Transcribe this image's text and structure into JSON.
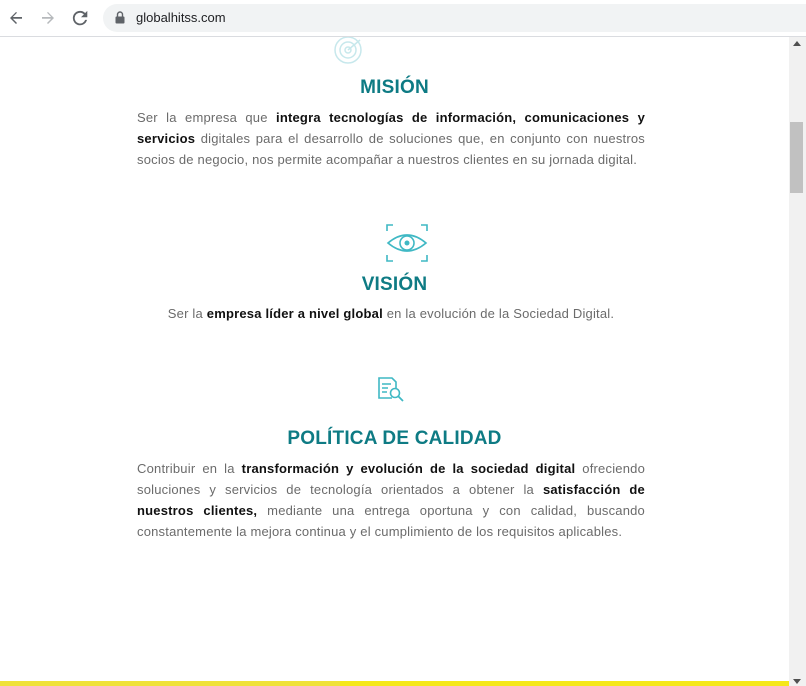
{
  "browser": {
    "url": "globalhitss.com",
    "icons": [
      "back-arrow-icon",
      "forward-arrow-icon",
      "reload-icon",
      "lock-icon"
    ]
  },
  "mision": {
    "title": "MISIÓN",
    "text": [
      {
        "t": "Ser la empresa que ",
        "b": false
      },
      {
        "t": "integra tecnologías de información, comunicaciones y servicios",
        "b": true
      },
      {
        "t": " digitales para el desarrollo de soluciones que, en conjunto con nuestros socios de negocio, nos permite acompañar a nuestros clientes en su jornada digital.",
        "b": false
      }
    ]
  },
  "vision": {
    "title": "VISIÓN",
    "icon": "eye-target-icon",
    "text": [
      {
        "t": "Ser la ",
        "b": false
      },
      {
        "t": "empresa líder a nivel global",
        "b": true
      },
      {
        "t": " en la evolución de la Sociedad Digital.",
        "b": false
      }
    ]
  },
  "calidad": {
    "title": "POLÍTICA DE CALIDAD",
    "icon": "document-search-icon",
    "text": [
      {
        "t": "Contribuir en la ",
        "b": false
      },
      {
        "t": "transformación y evolución de la sociedad digital",
        "b": true
      },
      {
        "t": " ofreciendo soluciones y servicios de tecnología orientados a obtener la ",
        "b": false
      },
      {
        "t": "satisfacción de nuestros clientes,",
        "b": true
      },
      {
        "t": " mediante una entrega oportuna y con calidad, buscando constantemente la mejora continua y el cumplimiento de los requisitos aplicables.",
        "b": false
      }
    ]
  },
  "colors": {
    "accent": "#0e7b84",
    "icon": "#3fb8c4",
    "bottom_bar": "#f5e71a"
  }
}
